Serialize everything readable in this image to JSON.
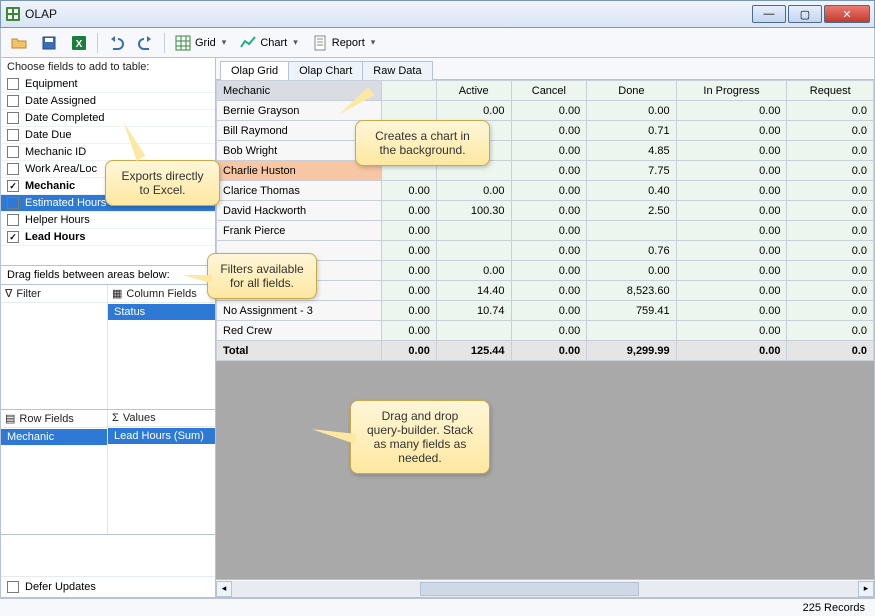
{
  "window": {
    "title": "OLAP"
  },
  "toolbar": {
    "grid_label": "Grid",
    "chart_label": "Chart",
    "report_label": "Report"
  },
  "left_panel": {
    "choose_label": "Choose fields to add to table:",
    "fields": [
      {
        "label": "Equipment",
        "checked": false
      },
      {
        "label": "Date Assigned",
        "checked": false
      },
      {
        "label": "Date Completed",
        "checked": false
      },
      {
        "label": "Date Due",
        "checked": false
      },
      {
        "label": "Mechanic ID",
        "checked": false
      },
      {
        "label": "Work Area/Loc",
        "checked": false
      },
      {
        "label": "Mechanic",
        "checked": true,
        "bold": true
      },
      {
        "label": "Estimated Hours",
        "checked": false,
        "selected": true
      },
      {
        "label": "Helper Hours",
        "checked": false
      },
      {
        "label": "Lead Hours",
        "checked": true,
        "bold": true
      }
    ],
    "drag_label": "Drag fields between areas below:",
    "areas": {
      "filter": {
        "title": "Filter",
        "items": []
      },
      "columns": {
        "title": "Column Fields",
        "items": [
          "Status"
        ]
      },
      "rows": {
        "title": "Row Fields",
        "items": [
          "Mechanic"
        ]
      },
      "values": {
        "title": "Values",
        "items": [
          "Lead Hours (Sum)"
        ]
      }
    },
    "defer_label": "Defer Updates"
  },
  "tabs": [
    "Olap Grid",
    "Olap Chart",
    "Raw Data"
  ],
  "active_tab": 0,
  "grid": {
    "corner": "Mechanic",
    "columns": [
      "",
      "Active",
      "Cancel",
      "Done",
      "In Progress",
      "Request"
    ],
    "rows": [
      {
        "label": "Bernie Grayson",
        "vals": [
          "",
          "0.00",
          "0.00",
          "0.00",
          "0.00",
          "0.0"
        ]
      },
      {
        "label": "Bill Raymond",
        "vals": [
          "",
          "",
          "0.00",
          "0.71",
          "0.00",
          "0.0"
        ]
      },
      {
        "label": "Bob Wright",
        "vals": [
          "",
          "",
          "0.00",
          "4.85",
          "0.00",
          "0.0"
        ]
      },
      {
        "label": "Charlie Huston",
        "hl": true,
        "vals": [
          "",
          "",
          "0.00",
          "7.75",
          "0.00",
          "0.0"
        ]
      },
      {
        "label": "Clarice Thomas",
        "vals": [
          "0.00",
          "0.00",
          "0.00",
          "0.40",
          "0.00",
          "0.0"
        ]
      },
      {
        "label": "David Hackworth",
        "vals": [
          "0.00",
          "100.30",
          "0.00",
          "2.50",
          "0.00",
          "0.0"
        ]
      },
      {
        "label": "Frank Pierce",
        "vals": [
          "0.00",
          "",
          "0.00",
          "",
          "0.00",
          "0.0"
        ]
      },
      {
        "label": "",
        "vals": [
          "0.00",
          "",
          "0.00",
          "0.76",
          "0.00",
          "0.0"
        ]
      },
      {
        "label": "",
        "vals": [
          "0.00",
          "0.00",
          "0.00",
          "0.00",
          "0.00",
          "0.0"
        ]
      },
      {
        "label": "",
        "vals": [
          "0.00",
          "14.40",
          "0.00",
          "8,523.60",
          "0.00",
          "0.0"
        ]
      },
      {
        "label": "No Assignment - 3",
        "vals": [
          "0.00",
          "10.74",
          "0.00",
          "759.41",
          "0.00",
          "0.0"
        ]
      },
      {
        "label": "Red Crew",
        "vals": [
          "0.00",
          "",
          "0.00",
          "",
          "0.00",
          "0.0"
        ]
      }
    ],
    "total": {
      "label": "Total",
      "vals": [
        "0.00",
        "125.44",
        "0.00",
        "9,299.99",
        "0.00",
        "0.0"
      ]
    }
  },
  "status": {
    "records": "225 Records"
  },
  "callouts": {
    "c1": "Exports directly to Excel.",
    "c2": "Creates a chart in the background.",
    "c3": "Filters available for all fields.",
    "c4": "Drag and drop query-builder. Stack as many fields as needed."
  }
}
